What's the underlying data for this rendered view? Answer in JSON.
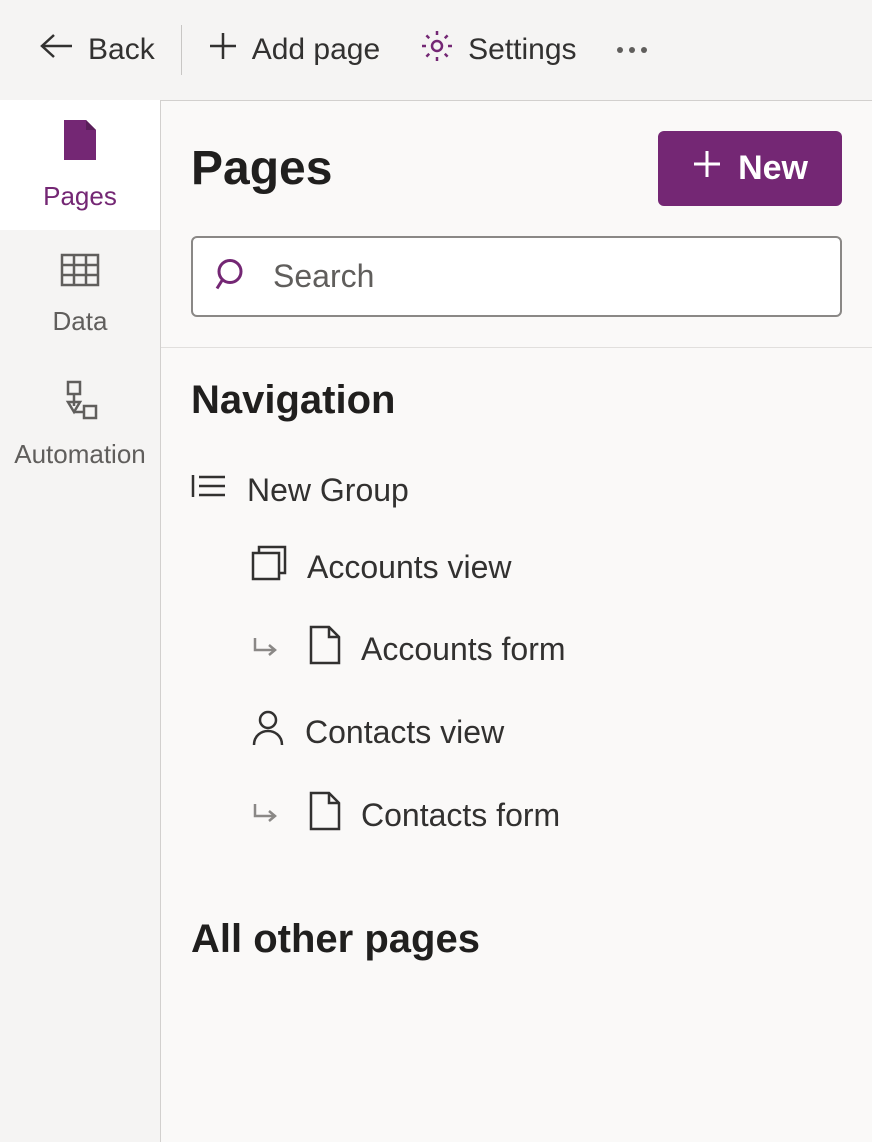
{
  "toolbar": {
    "back": "Back",
    "add_page": "Add page",
    "settings": "Settings"
  },
  "sidenav": {
    "pages": "Pages",
    "data": "Data",
    "automation": "Automation"
  },
  "panel": {
    "title": "Pages",
    "new_button": "New",
    "search_placeholder": "Search"
  },
  "navigation": {
    "heading": "Navigation",
    "group": "New Group",
    "items": [
      {
        "label": "Accounts view"
      },
      {
        "label": "Accounts form"
      },
      {
        "label": "Contacts view"
      },
      {
        "label": "Contacts form"
      }
    ]
  },
  "other": {
    "heading": "All other pages"
  }
}
